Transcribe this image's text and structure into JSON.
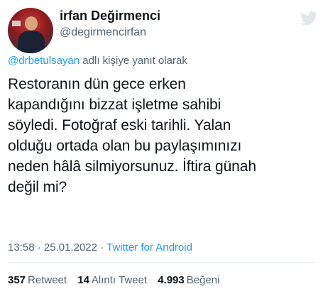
{
  "author": {
    "name": "irfan Değirmenci",
    "handle": "@degirmencirfan"
  },
  "reply": {
    "mention": "@drbetulsayan",
    "suffix": "adlı kişiye yanıt olarak"
  },
  "tweet": {
    "text": "Restoranın dün gece erken\nkapandığını bizzat işletme sahibi\nsöyledi. Fotoğraf eski tarihli. Yalan\nolduğu ortada olan bu paylaşımınızı\nneden hâlâ silmiyorsunuz. İftira günah\ndeğil mi?"
  },
  "meta": {
    "time": "13:58",
    "separator1": " · ",
    "date": "25.01.2022",
    "separator2": " · ",
    "source": "Twitter for Android"
  },
  "stats": {
    "retweets_count": "357",
    "retweets_label": "Retweet",
    "quotes_count": "14",
    "quotes_label": "Alıntı Tweet",
    "likes_count": "4.993",
    "likes_label": "Beğeni"
  },
  "colors": {
    "accent": "#1d9bf0",
    "text": "#0f1419",
    "secondary": "#536471"
  },
  "icons": {
    "logo": "twitter-bird-icon"
  }
}
